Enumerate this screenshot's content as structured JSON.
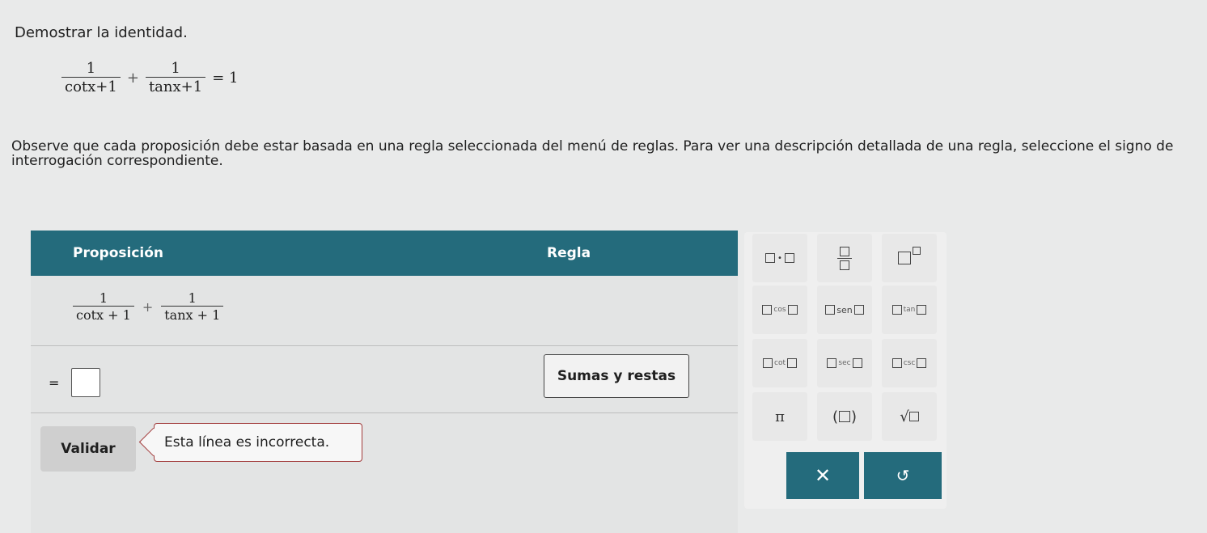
{
  "title": "Demostrar la identidad.",
  "identity": {
    "term1": {
      "numerator": "1",
      "denominator": "cotx+1"
    },
    "plus": "+",
    "term2": {
      "numerator": "1",
      "denominator": "tanx+1"
    },
    "rhs": "= 1"
  },
  "notice": "Observe que cada proposición debe estar basada en una regla seleccionada del menú de reglas. Para ver una descripción detallada de una regla, seleccione el signo de interrogación correspondiente.",
  "table": {
    "header_proposition": "Proposición",
    "header_rule": "Regla",
    "row1": {
      "term1": {
        "numerator": "1",
        "denominator": "cotx + 1"
      },
      "plus": "+",
      "term2": {
        "numerator": "1",
        "denominator": "tanx + 1"
      }
    },
    "row2": {
      "equals": "=",
      "rule": "Sumas y restas"
    }
  },
  "validate_label": "Validar",
  "feedback": "Esta línea es incorrecta.",
  "palette": {
    "cos": "cos",
    "sen": "sen",
    "tan": "tan",
    "cot": "cot",
    "sec": "sec",
    "csc": "csc",
    "pi": "π",
    "paren_open": "(",
    "paren_close": ")",
    "sqrt": "√",
    "clear": "✕",
    "undo": "↺"
  },
  "colors": {
    "header": "#246b7c",
    "error_border": "#a23b3b"
  }
}
